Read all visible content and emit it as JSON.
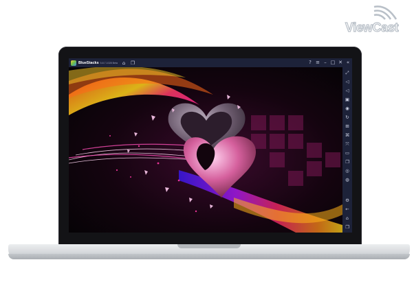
{
  "logo": {
    "text": "ViewCast"
  },
  "window": {
    "app_name": "BlueStacks",
    "version": "5.8.7.1028 Beta"
  },
  "titlebar": {
    "left_icons": [
      "home-icon",
      "multi-instance-icon"
    ],
    "right_icons": [
      "help-icon",
      "menu-icon",
      "minimize-icon",
      "restore-icon",
      "close-icon",
      "collapse-sidebar-icon"
    ]
  },
  "sidebar": {
    "icons": [
      "fullscreen-icon",
      "volume-up-icon",
      "volume-down-icon",
      "media-manager-icon",
      "screenshot-icon",
      "rotate-icon",
      "game-controls-icon",
      "macro-icon",
      "sync-icon",
      "folder-icon",
      "copy-icon",
      "eco-mode-icon",
      "settings-icon",
      "back-icon",
      "home-icon",
      "recent-apps-icon"
    ]
  },
  "colors": {
    "chrome": "#1d2239",
    "lid": "#131316"
  }
}
